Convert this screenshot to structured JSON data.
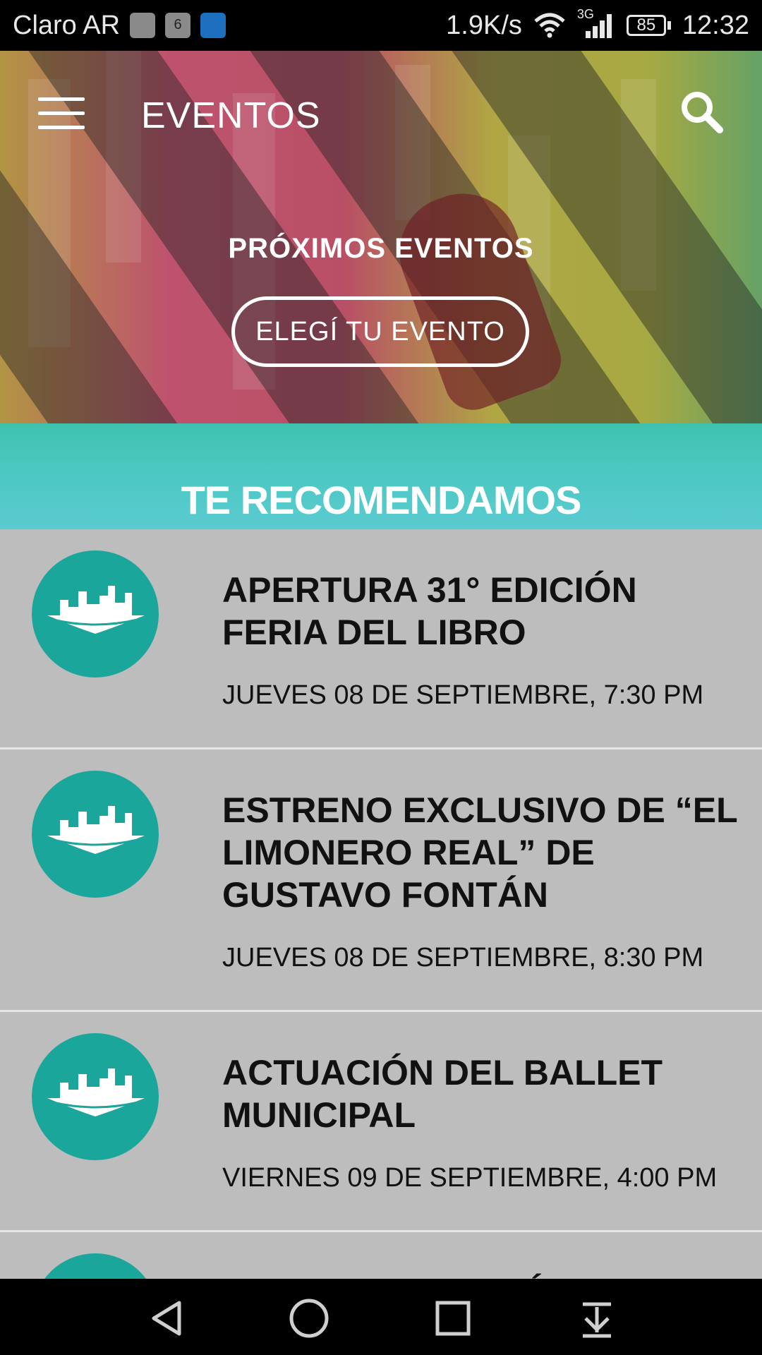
{
  "status_bar": {
    "carrier": "Claro AR",
    "notif_calendar_day": "6",
    "net_speed": "1.9K/s",
    "network_type": "3G",
    "battery": "85",
    "time": "12:32"
  },
  "header": {
    "title": "EVENTOS",
    "menu_icon": "hamburger-menu-icon",
    "search_icon": "search-icon"
  },
  "hero": {
    "subtitle": "PRÓXIMOS EVENTOS",
    "button_label": "ELEGÍ TU EVENTO"
  },
  "section": {
    "title": "TE RECOMENDAMOS"
  },
  "events": [
    {
      "title": "APERTURA 31° EDICIÓN FERIA DEL LIBRO",
      "date": "JUEVES 08 DE SEPTIEMBRE, 7:30 PM"
    },
    {
      "title": "ESTRENO EXCLUSIVO DE “EL LIMONERO REAL” DE GUSTAVO FONTÁN",
      "date": "JUEVES 08 DE SEPTIEMBRE, 8:30 PM"
    },
    {
      "title": "ACTUACIÓN DEL BALLET MUNICIPAL",
      "date": "VIERNES 09 DE SEPTIEMBRE, 4:00 PM"
    },
    {
      "title": "TALLER DE EDICIÓN DE",
      "date": ""
    }
  ],
  "colors": {
    "teal": "#1aa69a",
    "list_background": "#bdbdbd",
    "band_teal": "#4cc8c2"
  },
  "nav": {
    "back_icon": "back-triangle-icon",
    "home_icon": "home-circle-icon",
    "recents_icon": "recents-square-icon",
    "notifications_icon": "pull-down-notifications-icon"
  }
}
